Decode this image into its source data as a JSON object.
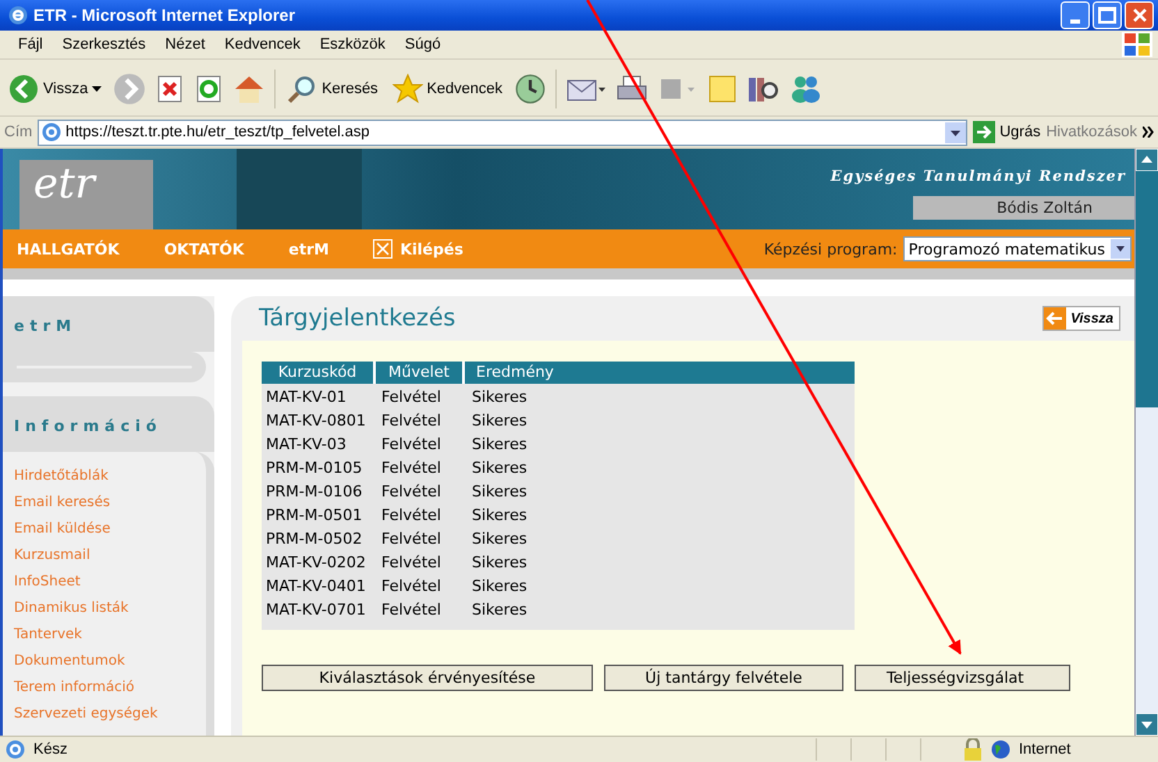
{
  "window": {
    "title": "ETR - Microsoft Internet Explorer"
  },
  "menu": [
    "Fájl",
    "Szerkesztés",
    "Nézet",
    "Kedvencek",
    "Eszközök",
    "Súgó"
  ],
  "toolbar": {
    "back": "Vissza",
    "search": "Keresés",
    "favorites": "Kedvencek"
  },
  "address": {
    "label": "Cím",
    "url": "https://teszt.tr.pte.hu/etr_teszt/tp_felvetel.asp",
    "go": "Ugrás",
    "links": "Hivatkozások"
  },
  "banner": {
    "logo": "etr",
    "system_name": "Egységes Tanulmányi Rendszer",
    "user": "Bódis Zoltán"
  },
  "nav": {
    "items": [
      "HALLGATÓK",
      "OKTATÓK",
      "etrM"
    ],
    "logout": "Kilépés",
    "program_label": "Képzési program:",
    "program": "Programozó matematikus"
  },
  "sidebar": {
    "sections": [
      {
        "title": "etrM"
      },
      {
        "title": "Információ",
        "links": [
          "Hirdetőtáblák",
          "Email keresés",
          "Email küldése",
          "Kurzusmail",
          "InfoSheet",
          "Dinamikus listák",
          "Tantervek",
          "Dokumentumok",
          "Terem információ",
          "Szervezeti egységek"
        ]
      }
    ]
  },
  "content": {
    "title": "Tárgyjelentkezés",
    "back_button": "Vissza",
    "table": {
      "columns": [
        "Kurzuskód",
        "Művelet",
        "Eredmény"
      ],
      "rows": [
        [
          "MAT-KV-01",
          "Felvétel",
          "Sikeres"
        ],
        [
          "MAT-KV-0801",
          "Felvétel",
          "Sikeres"
        ],
        [
          "MAT-KV-03",
          "Felvétel",
          "Sikeres"
        ],
        [
          "PRM-M-0105",
          "Felvétel",
          "Sikeres"
        ],
        [
          "PRM-M-0106",
          "Felvétel",
          "Sikeres"
        ],
        [
          "PRM-M-0501",
          "Felvétel",
          "Sikeres"
        ],
        [
          "PRM-M-0502",
          "Felvétel",
          "Sikeres"
        ],
        [
          "MAT-KV-0202",
          "Felvétel",
          "Sikeres"
        ],
        [
          "MAT-KV-0401",
          "Felvétel",
          "Sikeres"
        ],
        [
          "MAT-KV-0701",
          "Felvétel",
          "Sikeres"
        ]
      ]
    },
    "buttons": [
      "Kiválasztások érvényesítése",
      "Új tantárgy felvétele",
      "Teljességvizsgálat"
    ]
  },
  "status_bar": {
    "text": "Kész",
    "zone": "Internet"
  }
}
